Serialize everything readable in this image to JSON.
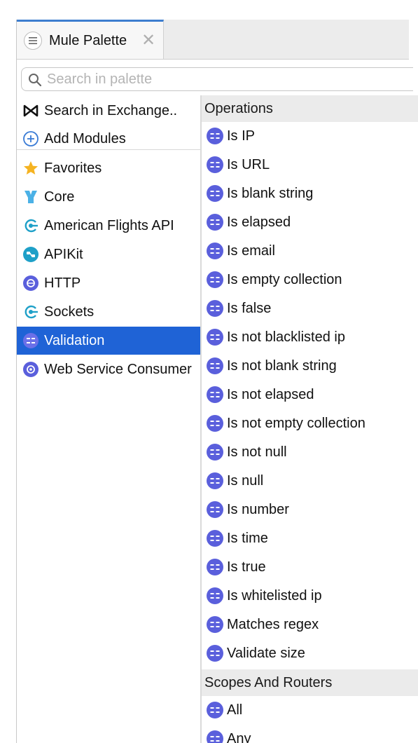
{
  "tab": {
    "title": "Mule Palette",
    "close": "✕"
  },
  "search": {
    "placeholder": "Search in palette",
    "value": ""
  },
  "categories": {
    "top": [
      {
        "label": "Search in Exchange..",
        "icon": "exchange-icon"
      },
      {
        "label": "Add Modules",
        "icon": "add-circle-icon"
      }
    ],
    "items": [
      {
        "label": "Favorites",
        "icon": "star-icon"
      },
      {
        "label": "Core",
        "icon": "core-icon"
      },
      {
        "label": "American Flights API",
        "icon": "api-connector-icon"
      },
      {
        "label": "APIKit",
        "icon": "apikit-icon"
      },
      {
        "label": "HTTP",
        "icon": "http-icon"
      },
      {
        "label": "Sockets",
        "icon": "sockets-icon"
      },
      {
        "label": "Validation",
        "icon": "validation-icon",
        "selected": true
      },
      {
        "label": "Web Service Consumer",
        "icon": "web-service-icon"
      }
    ]
  },
  "operations": {
    "header": "Operations",
    "items": [
      "Is IP",
      "Is URL",
      "Is blank string",
      "Is elapsed",
      "Is email",
      "Is empty collection",
      "Is false",
      "Is not blacklisted ip",
      "Is not blank string",
      "Is not elapsed",
      "Is not empty collection",
      "Is not null",
      "Is null",
      "Is number",
      "Is time",
      "Is true",
      "Is whitelisted ip",
      "Matches regex",
      "Validate size"
    ]
  },
  "scopes": {
    "header": "Scopes And Routers",
    "items": [
      "All",
      "Any"
    ]
  },
  "colors": {
    "selection": "#1f63d6",
    "icon_purple": "#5a5fdc",
    "api_teal": "#1ea0c8",
    "star": "#f5b321"
  }
}
